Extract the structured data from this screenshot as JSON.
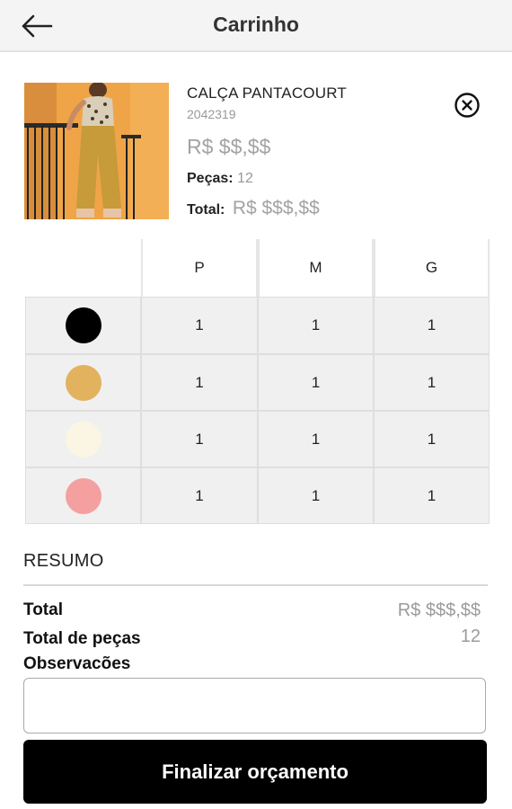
{
  "header": {
    "back_icon": "arrow-left-icon",
    "title": "Carrinho"
  },
  "product": {
    "name": "CALÇA PANTACOURT",
    "code": "2042319",
    "price": "R$ $$,$$",
    "pieces_label": "Peças:",
    "pieces_value": "12",
    "total_label": "Total:",
    "total_value": "R$ $$$,$$",
    "remove_icon": "close-circle-icon"
  },
  "grid": {
    "sizes": [
      "P",
      "M",
      "G"
    ],
    "rows": [
      {
        "color": "#000000",
        "qty": [
          "1",
          "1",
          "1"
        ]
      },
      {
        "color": "#E3B25E",
        "qty": [
          "1",
          "1",
          "1"
        ]
      },
      {
        "color": "#FBF6E4",
        "qty": [
          "1",
          "1",
          "1"
        ]
      },
      {
        "color": "#F4A0A0",
        "qty": [
          "1",
          "1",
          "1"
        ]
      }
    ]
  },
  "summary": {
    "heading": "RESUMO",
    "total_label": "Total",
    "total_value": "R$ $$$,$$",
    "pieces_label": "Total de peças",
    "pieces_value": "12",
    "notes_label": "Observacões",
    "notes_value": ""
  },
  "actions": {
    "submit_label": "Finalizar orçamento"
  }
}
